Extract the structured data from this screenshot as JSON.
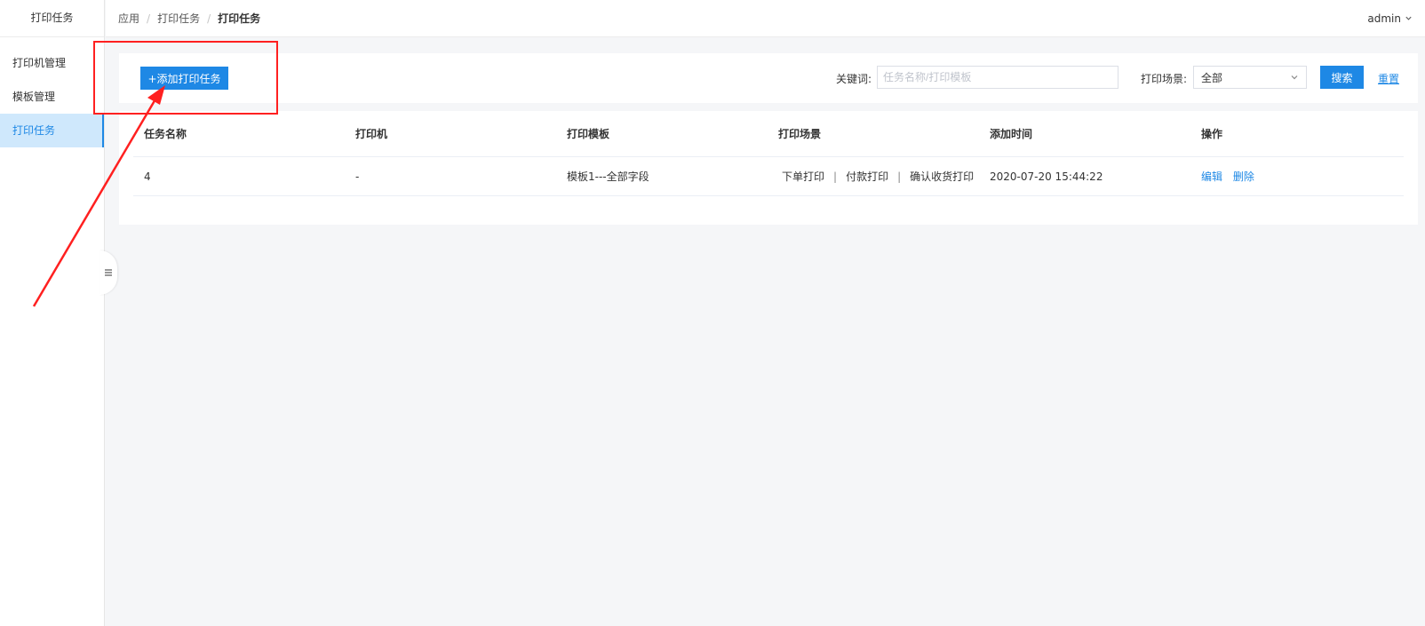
{
  "sidebar": {
    "title": "打印任务",
    "items": [
      {
        "label": "打印机管理",
        "active": false
      },
      {
        "label": "模板管理",
        "active": false
      },
      {
        "label": "打印任务",
        "active": true
      }
    ]
  },
  "header": {
    "breadcrumb": [
      "应用",
      "打印任务",
      "打印任务"
    ],
    "user": "admin"
  },
  "filters": {
    "add_label": "+添加打印任务",
    "keyword_label": "关键词:",
    "keyword_placeholder": "任务名称/打印模板",
    "keyword_value": "",
    "scene_label": "打印场景:",
    "scene_value": "全部",
    "search_label": "搜索",
    "reset_label": "重置"
  },
  "table": {
    "columns": [
      "任务名称",
      "打印机",
      "打印模板",
      "打印场景",
      "添加时间",
      "操作"
    ],
    "rows": [
      {
        "name": "4",
        "printer": "-",
        "template": "模板1---全部字段",
        "scenes": [
          "下单打印",
          "付款打印",
          "确认收货打印"
        ],
        "added": "2020-07-20 15:44:22",
        "actions": [
          "编辑",
          "删除"
        ]
      }
    ]
  },
  "colors": {
    "accent": "#1e88e5",
    "annotation": "#ff2020",
    "active_bg": "#cfe8fc"
  },
  "icons": {
    "user_menu": "chevron-down-icon",
    "select": "chevron-down-icon",
    "collapse": "menu-icon"
  }
}
